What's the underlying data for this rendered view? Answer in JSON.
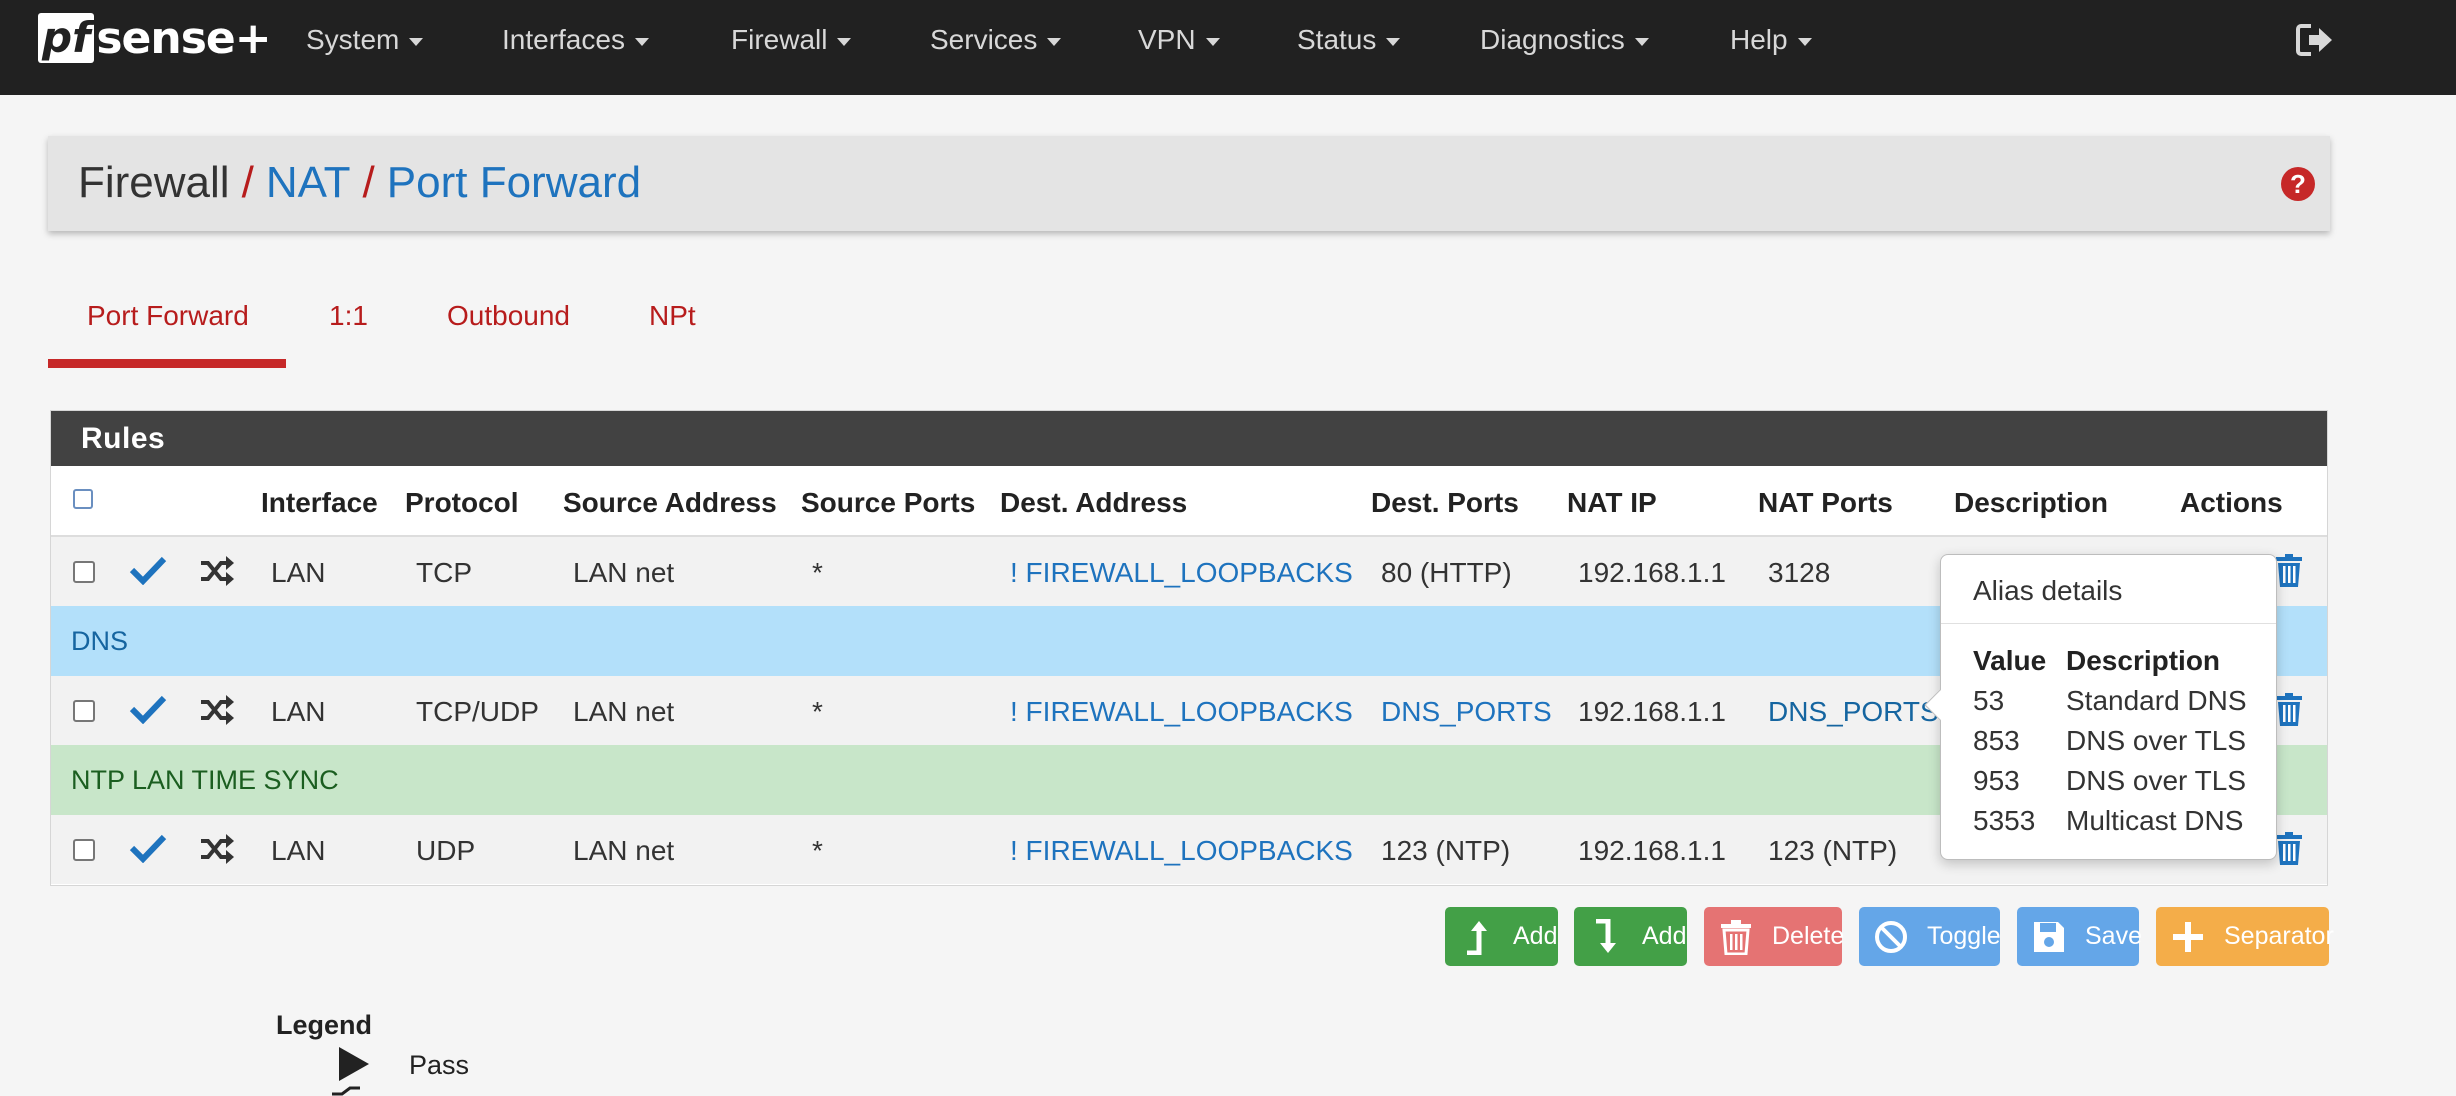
{
  "navbar": {
    "logo_pf": "pf",
    "logo_rest": "sense+",
    "menu": [
      "System",
      "Interfaces",
      "Firewall",
      "Services",
      "VPN",
      "Status",
      "Diagnostics",
      "Help"
    ],
    "logout_icon": "sign-out-icon"
  },
  "breadcrumb": {
    "first": "Firewall",
    "second": "NAT",
    "third": "Port Forward",
    "separator": "/",
    "help_icon": "?"
  },
  "tabs": [
    {
      "label": "Port Forward",
      "active": true
    },
    {
      "label": "1:1",
      "active": false
    },
    {
      "label": "Outbound",
      "active": false
    },
    {
      "label": "NPt",
      "active": false
    }
  ],
  "rules": {
    "title": "Rules",
    "columns": [
      "Interface",
      "Protocol",
      "Source Address",
      "Source Ports",
      "Dest. Address",
      "Dest. Ports",
      "NAT IP",
      "NAT Ports",
      "Description",
      "Actions"
    ],
    "rows": [
      {
        "interface": "LAN",
        "protocol": "TCP",
        "source_address": "LAN net",
        "source_ports": "*",
        "dest_address": "! FIREWALL_LOOPBACKS",
        "dest_ports": "80 (HTTP)",
        "nat_ip": "192.168.1.1",
        "nat_ports": "3128",
        "description": ""
      },
      {
        "interface": "LAN",
        "protocol": "TCP/UDP",
        "source_address": "LAN net",
        "source_ports": "*",
        "dest_address": "! FIREWALL_LOOPBACKS",
        "dest_ports": "DNS_PORTS",
        "nat_ip": "192.168.1.1",
        "nat_ports": "DNS_PORTS",
        "description": ""
      },
      {
        "interface": "LAN",
        "protocol": "UDP",
        "source_address": "LAN net",
        "source_ports": "*",
        "dest_address": "! FIREWALL_LOOPBACKS",
        "dest_ports": "123 (NTP)",
        "nat_ip": "192.168.1.1",
        "nat_ports": "123 (NTP)",
        "description": ""
      }
    ],
    "separators": [
      "DNS",
      "NTP LAN TIME SYNC"
    ]
  },
  "tooltip": {
    "title": "Alias details",
    "col_value": "Value",
    "col_description": "Description",
    "entries": [
      {
        "value": "53",
        "description": "Standard DNS"
      },
      {
        "value": "853",
        "description": "DNS over TLS"
      },
      {
        "value": "953",
        "description": "DNS over TLS"
      },
      {
        "value": "5353",
        "description": "Multicast DNS"
      }
    ]
  },
  "buttons": {
    "add_top": "Add",
    "add_bottom": "Add",
    "delete": "Delete",
    "toggle": "Toggle",
    "save": "Save",
    "separator": "Separator"
  },
  "legend": {
    "title": "Legend",
    "pass": "Pass"
  },
  "colors": {
    "accent_red": "#c62828",
    "link_blue": "#1e73be",
    "navbar": "#212121"
  }
}
